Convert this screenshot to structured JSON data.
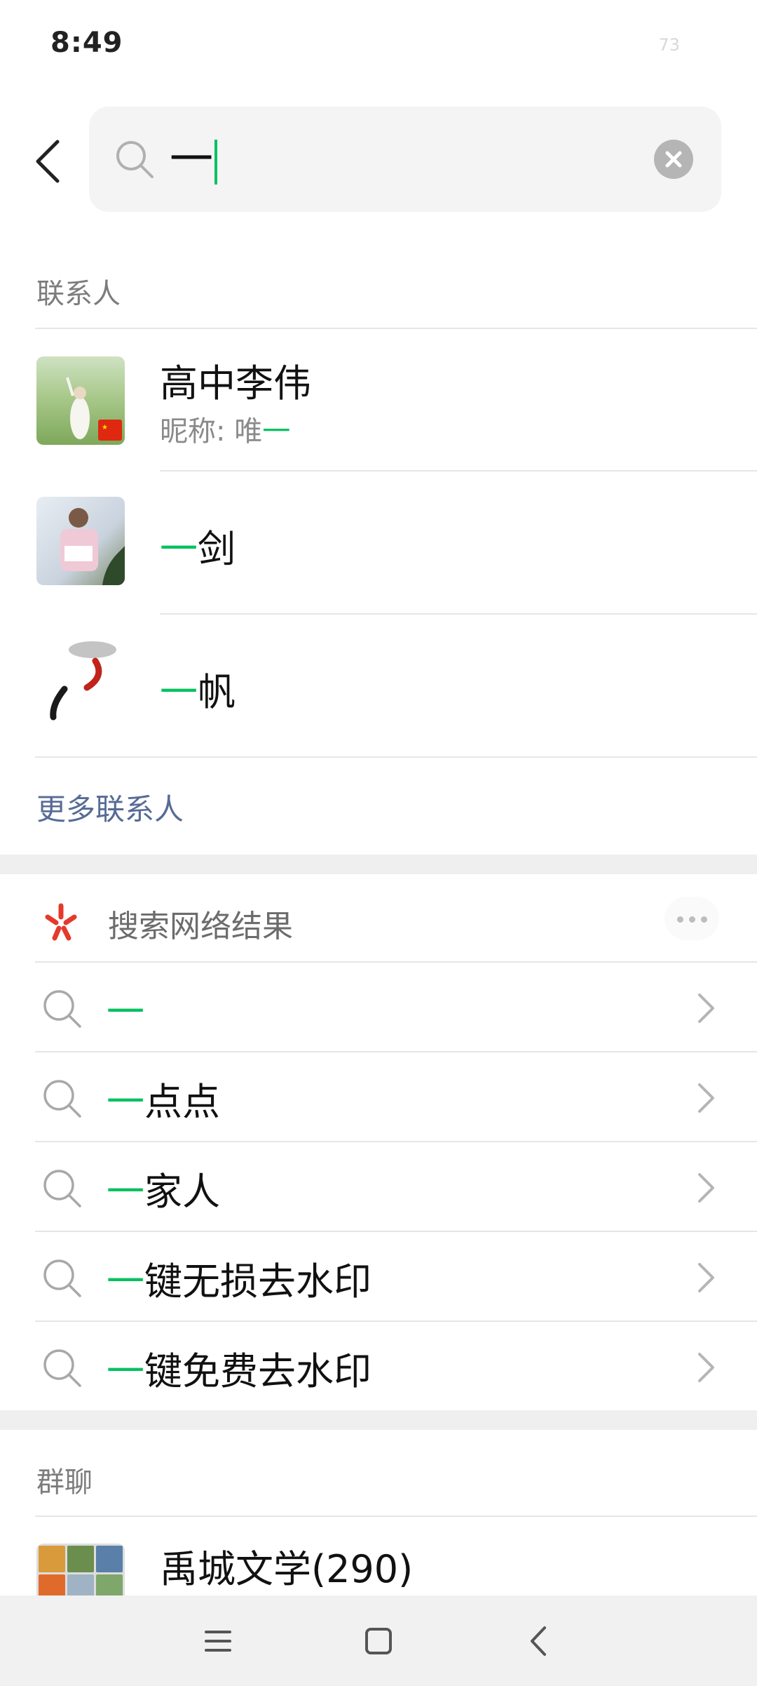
{
  "status_bar": {
    "time": "8:49",
    "battery": "73"
  },
  "search": {
    "highlight": "一"
  },
  "contacts_section": {
    "title": "联系人",
    "items": [
      {
        "name_plain": "高中李伟",
        "sub_label": "昵称: 唯",
        "sub_highlight": "一"
      },
      {
        "name_highlight": "一",
        "name_rest": "剑"
      },
      {
        "name_highlight": "一",
        "name_rest": "帆"
      }
    ],
    "more_label": "更多联系人"
  },
  "web_section": {
    "title": "搜索网络结果",
    "results": [
      {
        "highlight": "一",
        "rest": ""
      },
      {
        "highlight": "一",
        "rest": "点点"
      },
      {
        "highlight": "一",
        "rest": "家人"
      },
      {
        "highlight": "一",
        "rest": "键无损去水印"
      },
      {
        "highlight": "一",
        "rest": "键免费去水印"
      }
    ]
  },
  "groups_section": {
    "title": "群聊",
    "items": [
      {
        "name": "禹城文学(290)"
      }
    ]
  },
  "colors": {
    "accent": "#07c160",
    "link": "#576b95"
  },
  "icons": [
    "back-arrow-icon",
    "search-icon",
    "clear-icon",
    "web-search-icon",
    "more-dots-icon",
    "chevron-right-icon",
    "menu-icon",
    "home-icon",
    "nav-back-icon"
  ]
}
